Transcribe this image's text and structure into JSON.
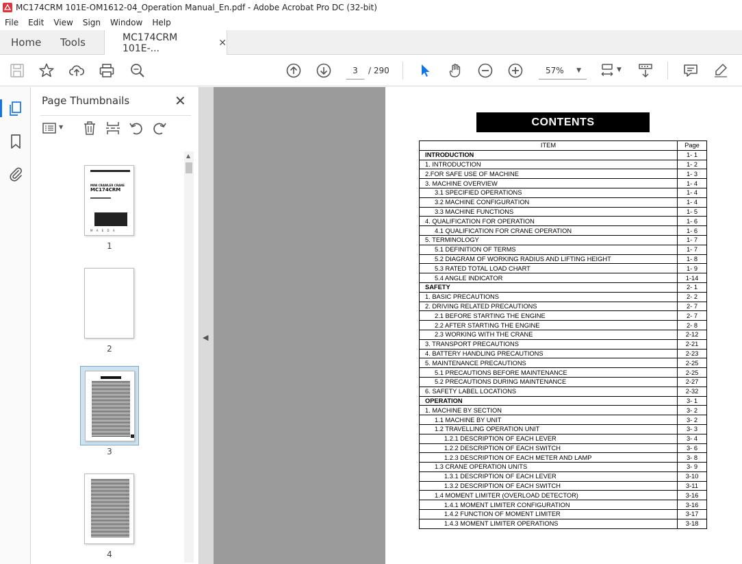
{
  "window": {
    "title": "MC174CRM 101E-OM1612-04_Operation Manual_En.pdf - Adobe Acrobat Pro DC (32-bit)"
  },
  "menu": [
    "File",
    "Edit",
    "View",
    "Sign",
    "Window",
    "Help"
  ],
  "tabs": {
    "home": "Home",
    "tools": "Tools",
    "document": "MC174CRM 101E-..."
  },
  "toolbar": {
    "current_page": "3",
    "total_pages": "/ 290",
    "zoom": "57%"
  },
  "thumbnails": {
    "title": "Page Thumbnails",
    "pages": [
      "1",
      "2",
      "3",
      "4"
    ],
    "selected_page": "3",
    "cover_lines": [
      "MINI CRAWLER CRANE",
      "MC174CRM",
      "M A E D A"
    ]
  },
  "document": {
    "contents_title": "CONTENTS",
    "table_headers": {
      "item": "ITEM",
      "page": "Page"
    },
    "rows": [
      {
        "item": "INTRODUCTION",
        "page": "1- 1",
        "level": 0,
        "section": true
      },
      {
        "item": "1. INTRODUCTION",
        "page": "1- 2",
        "level": 0
      },
      {
        "item": "2.FOR SAFE USE OF MACHINE",
        "page": "1- 3",
        "level": 0
      },
      {
        "item": "3. MACHINE OVERVIEW",
        "page": "1- 4",
        "level": 0
      },
      {
        "item": "3.1 SPECIFIED OPERATIONS",
        "page": "1- 4",
        "level": 1
      },
      {
        "item": "3.2 MACHINE CONFIGURATION",
        "page": "1- 4",
        "level": 1
      },
      {
        "item": "3.3 MACHINE FUNCTIONS",
        "page": "1- 5",
        "level": 1
      },
      {
        "item": "4. QUALIFICATION FOR OPERATION",
        "page": "1- 6",
        "level": 0
      },
      {
        "item": "4.1 QUALIFICATION FOR CRANE OPERATION",
        "page": "1- 6",
        "level": 1
      },
      {
        "item": "5. TERMINOLOGY",
        "page": "1- 7",
        "level": 0
      },
      {
        "item": "5.1 DEFINITION OF TERMS",
        "page": "1- 7",
        "level": 1
      },
      {
        "item": "5.2 DIAGRAM OF WORKING RADIUS AND LIFTING HEIGHT",
        "page": "1- 8",
        "level": 1
      },
      {
        "item": "5.3 RATED TOTAL LOAD CHART",
        "page": "1- 9",
        "level": 1
      },
      {
        "item": "5.4 ANGLE INDICATOR",
        "page": "1-14",
        "level": 1
      },
      {
        "item": "SAFETY",
        "page": "2- 1",
        "level": 0,
        "section": true
      },
      {
        "item": "1. BASIC PRECAUTIONS",
        "page": "2- 2",
        "level": 0
      },
      {
        "item": "2. DRIVING RELATED PRECAUTIONS",
        "page": "2- 7",
        "level": 0
      },
      {
        "item": "2.1 BEFORE STARTING THE ENGINE",
        "page": "2- 7",
        "level": 1
      },
      {
        "item": "2.2 AFTER STARTING THE ENGINE",
        "page": "2- 8",
        "level": 1
      },
      {
        "item": "2.3 WORKING WITH THE CRANE",
        "page": "2-12",
        "level": 1
      },
      {
        "item": "3. TRANSPORT PRECAUTIONS",
        "page": "2-21",
        "level": 0
      },
      {
        "item": "4. BATTERY HANDLING PRECAUTIONS",
        "page": "2-23",
        "level": 0
      },
      {
        "item": "5. MAINTENANCE PRECAUTIONS",
        "page": "2-25",
        "level": 0
      },
      {
        "item": "5.1 PRECAUTIONS BEFORE MAINTENANCE",
        "page": "2-25",
        "level": 1
      },
      {
        "item": "5.2 PRECAUTIONS DURING MAINTENANCE",
        "page": "2-27",
        "level": 1
      },
      {
        "item": "6. SAFETY LABEL LOCATIONS",
        "page": "2-32",
        "level": 0
      },
      {
        "item": "OPERATION",
        "page": "3- 1",
        "level": 0,
        "section": true
      },
      {
        "item": "1. MACHINE BY SECTION",
        "page": "3- 2",
        "level": 0
      },
      {
        "item": "1.1 MACHINE BY UNIT",
        "page": "3- 2",
        "level": 1
      },
      {
        "item": "1.2 TRAVELLING OPERATION UNIT",
        "page": "3- 3",
        "level": 1
      },
      {
        "item": "1.2.1 DESCRIPTION OF EACH LEVER",
        "page": "3- 4",
        "level": 2
      },
      {
        "item": "1.2.2 DESCRIPTION OF EACH SWITCH",
        "page": "3- 6",
        "level": 2
      },
      {
        "item": "1.2.3 DESCRIPTION OF EACH METER AND LAMP",
        "page": "3- 8",
        "level": 2
      },
      {
        "item": "1.3 CRANE OPERATION UNITS",
        "page": "3- 9",
        "level": 1
      },
      {
        "item": "1.3.1 DESCRIPTION OF EACH LEVER",
        "page": "3-10",
        "level": 2
      },
      {
        "item": "1.3.2 DESCRIPTION OF EACH SWITCH",
        "page": "3-11",
        "level": 2
      },
      {
        "item": "1.4 MOMENT LIMITER (OVERLOAD DETECTOR)",
        "page": "3-16",
        "level": 1
      },
      {
        "item": "1.4.1 MOMENT LIMITER CONFIGURATION",
        "page": "3-16",
        "level": 2
      },
      {
        "item": "1.4.2 FUNCTION OF MOMENT LIMITER",
        "page": "3-17",
        "level": 2
      },
      {
        "item": "1.4.3 MOMENT LIMITER OPERATIONS",
        "page": "3-18",
        "level": 2
      }
    ]
  },
  "colors": {
    "accent": "#1473e6",
    "adobe_red": "#d7373f",
    "viewer_gray": "#9b9b9b",
    "selection": "#cfe3f1"
  }
}
